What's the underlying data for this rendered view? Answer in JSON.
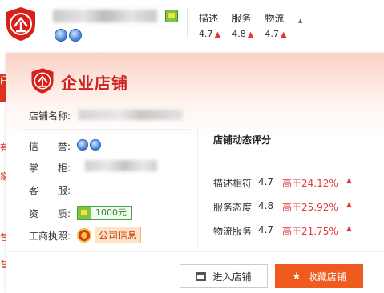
{
  "header": {
    "scores": [
      {
        "label": "描述",
        "value": "4.7"
      },
      {
        "label": "服务",
        "value": "4.8"
      },
      {
        "label": "物流",
        "value": "4.7"
      }
    ]
  },
  "panel": {
    "title": "企业店铺",
    "shop_name_label": "店铺名称:",
    "rows": [
      {
        "label": "信　　誉:"
      },
      {
        "label": "掌　　柜:"
      },
      {
        "label": "客　　服:"
      },
      {
        "label": "资　　质:"
      },
      {
        "label": "工商执照:"
      }
    ],
    "deposit": "1000元",
    "company_info": "公司信息",
    "dynamic": {
      "title": "店铺动态评分",
      "rows": [
        {
          "label": "描述相符",
          "value": "4.7",
          "compare": "高于24.12%"
        },
        {
          "label": "服务态度",
          "value": "4.8",
          "compare": "高于25.92%"
        },
        {
          "label": "物流服务",
          "value": "4.7",
          "compare": "高于21.75%"
        }
      ]
    },
    "buttons": {
      "enter": "进入店铺",
      "favorite": "收藏店铺"
    }
  },
  "left_strip": [
    "闩",
    "有",
    "家",
    "昔",
    "昔"
  ],
  "colors": {
    "brand_red": "#c22",
    "accent_orange": "#ef5a1e",
    "up_red": "#e4393c"
  },
  "icons": [
    "enterprise-badge-icon",
    "crown-icon",
    "diamond-icon",
    "up-arrow-icon",
    "deposit-icon",
    "business-license-seal-icon",
    "shop-icon",
    "star-icon",
    "caret-down-icon"
  ]
}
